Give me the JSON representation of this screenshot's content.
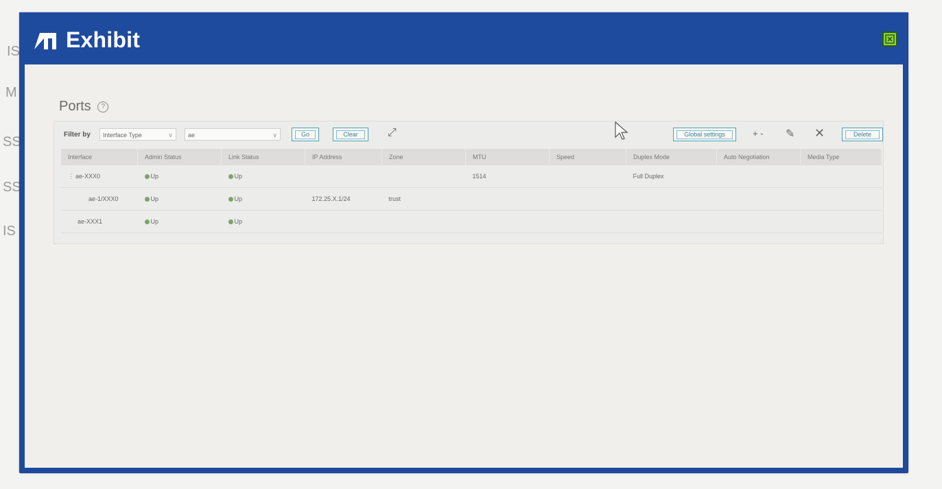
{
  "exhibit": {
    "title": "Exhibit"
  },
  "panel": {
    "title": "Ports",
    "help": "?"
  },
  "toolbar": {
    "filter_label": "Filter by",
    "filter_field": "Interface Type",
    "filter_value": "ae",
    "go_label": "Go",
    "clear_label": "Clear",
    "global_settings_label": "Global settings",
    "add_label": "+ -",
    "delete_label": "Delete"
  },
  "table": {
    "headers": [
      "Interface",
      "Admin Status",
      "Link Status",
      "IP Address",
      "Zone",
      "MTU",
      "Speed",
      "Duplex Mode",
      "Auto Negotiation",
      "Media Type"
    ],
    "rows": [
      {
        "interface": "ae-XXX0",
        "admin": "Up",
        "link": "Up",
        "ip": "",
        "zone": "",
        "mtu": "1514",
        "speed": "",
        "duplex": "Full Duplex",
        "auto": "",
        "media": ""
      },
      {
        "interface": "ae-1/XXX0",
        "admin": "Up",
        "link": "Up",
        "ip": "172.25.X.1/24",
        "zone": "trust",
        "mtu": "",
        "speed": "",
        "duplex": "",
        "auto": "",
        "media": ""
      },
      {
        "interface": "ae-XXX1",
        "admin": "Up",
        "link": "Up",
        "ip": "",
        "zone": "",
        "mtu": "",
        "speed": "",
        "duplex": "",
        "auto": "",
        "media": ""
      }
    ]
  },
  "background": {
    "fragments": [
      "IS",
      "M",
      "SS",
      "SS",
      "IS"
    ]
  },
  "colors": {
    "header_blue": "#1f4b9e",
    "status_green": "#7aa56a",
    "accent_teal": "#4a9fb5"
  }
}
